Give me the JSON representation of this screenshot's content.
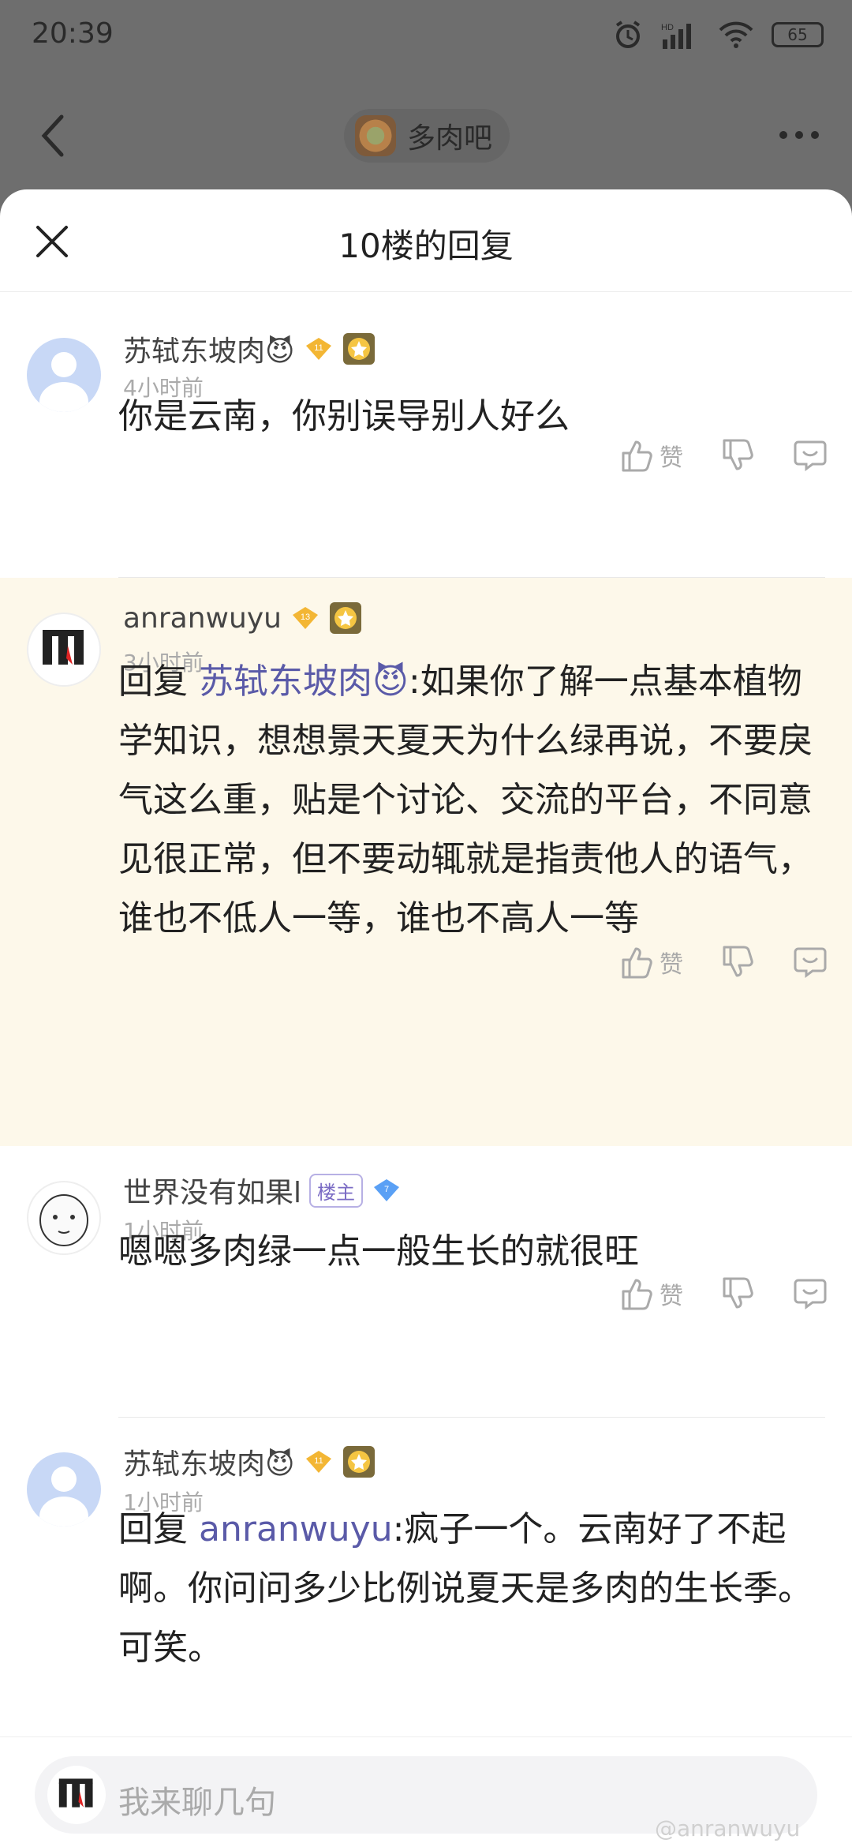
{
  "status": {
    "time": "20:39",
    "battery": "65"
  },
  "header": {
    "forum_name": "多肉吧"
  },
  "sheet": {
    "title": "10楼的回复"
  },
  "actions": {
    "like_label": "赞"
  },
  "replies": [
    {
      "user": "苏轼东坡肉😈",
      "level": "11",
      "time": "4小时前",
      "text": "你是云南，你别误导别人好么"
    },
    {
      "user": "anranwuyu",
      "level": "13",
      "time": "3小时前",
      "reply_prefix": "回复 ",
      "mention": "苏轼东坡肉😈",
      "text": ":如果你了解一点基本植物学知识，想想景天夏天为什么绿再说，不要戾气这么重，贴是个讨论、交流的平台，不同意见很正常，但不要动辄就是指责他人的语气，谁也不低人一等，谁也不高人一等"
    },
    {
      "user": "世界没有如果l",
      "tag": "楼主",
      "level": "7",
      "time": "1小时前",
      "text": "嗯嗯多肉绿一点一般生长的就很旺"
    },
    {
      "user": "苏轼东坡肉😈",
      "level": "11",
      "time": "1小时前",
      "reply_prefix": "回复 ",
      "mention": "anranwuyu",
      "text": ":疯子一个。云南好了不起啊。你问问多少比例说夏天是多肉的生长季。可笑。"
    }
  ],
  "composer": {
    "placeholder": "我来聊几句"
  },
  "watermark": "@anranwuyu"
}
